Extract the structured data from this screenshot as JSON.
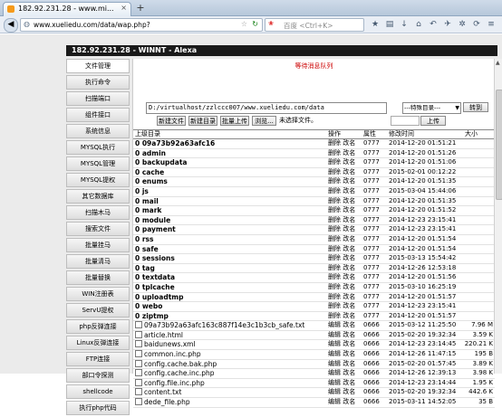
{
  "browser": {
    "tab_title": "182.92.231.28 - WINNT - Alexa",
    "tab_title_short": "182.92.231.28 - www.mi...",
    "tab_close": "×",
    "new_tab": "+",
    "url": "www.xueliedu.com/data/wap.php?",
    "search_placeholder": "百度 <Ctrl+K>"
  },
  "app": {
    "title": "182.92.231.28 - WINNT - Alexa",
    "status": "等待消息队列",
    "sidebar": [
      "文件管理",
      "执行命令",
      "扫描端口",
      "组件接口",
      "系统信息",
      "MYSQL执行",
      "MYSQL管理",
      "MYSQL提权",
      "其它数据库",
      "扫描木马",
      "搜索文件",
      "批量挂马",
      "批量清马",
      "批量替换",
      "WIN注册表",
      "ServU提权",
      "php反弹连接",
      "Linux反弹连接",
      "FTP连接",
      "部口令探测",
      "shellcode",
      "执行php代码"
    ],
    "path_value": "D:/virtualhost/zzlccc007/www.xueliedu.com/data",
    "special_dir": "---特殊目录---",
    "go_button": "转到",
    "buttons": [
      "新建文件",
      "新建目录",
      "批量上传",
      "浏览..."
    ],
    "no_file": "未选择文件。",
    "upload_button": "上传",
    "columns": [
      "上级目录",
      "操作",
      "属性",
      "修改时间",
      "大小"
    ],
    "dirs": [
      {
        "name": "0 09a73b92a63afc16",
        "ops": "删除 改名",
        "perm": "0777",
        "time": "2014-12-20 01:51:21"
      },
      {
        "name": "0 admin",
        "ops": "删除 改名",
        "perm": "0777",
        "time": "2014-12-20 01:51:26"
      },
      {
        "name": "0 backupdata",
        "ops": "删除 改名",
        "perm": "0777",
        "time": "2014-12-20 01:51:06"
      },
      {
        "name": "0 cache",
        "ops": "删除 改名",
        "perm": "0777",
        "time": "2015-02-01 00:12:22"
      },
      {
        "name": "0 enums",
        "ops": "删除 改名",
        "perm": "0777",
        "time": "2014-12-20 01:51:35"
      },
      {
        "name": "0 js",
        "ops": "删除 改名",
        "perm": "0777",
        "time": "2015-03-04 15:44:06"
      },
      {
        "name": "0 mail",
        "ops": "删除 改名",
        "perm": "0777",
        "time": "2014-12-20 01:51:35"
      },
      {
        "name": "0 mark",
        "ops": "删除 改名",
        "perm": "0777",
        "time": "2014-12-20 01:51:52"
      },
      {
        "name": "0 module",
        "ops": "删除 改名",
        "perm": "0777",
        "time": "2014-12-23 23:15:41"
      },
      {
        "name": "0 payment",
        "ops": "删除 改名",
        "perm": "0777",
        "time": "2014-12-23 23:15:41"
      },
      {
        "name": "0 rss",
        "ops": "删除 改名",
        "perm": "0777",
        "time": "2014-12-20 01:51:54"
      },
      {
        "name": "0 safe",
        "ops": "删除 改名",
        "perm": "0777",
        "time": "2014-12-20 01:51:54"
      },
      {
        "name": "0 sessions",
        "ops": "删除 改名",
        "perm": "0777",
        "time": "2015-03-13 15:54:42"
      },
      {
        "name": "0 tag",
        "ops": "删除 改名",
        "perm": "0777",
        "time": "2014-12-26 12:53:18"
      },
      {
        "name": "0 textdata",
        "ops": "删除 改名",
        "perm": "0777",
        "time": "2014-12-20 01:51:56"
      },
      {
        "name": "0 tplcache",
        "ops": "删除 改名",
        "perm": "0777",
        "time": "2015-03-10 16:25:19"
      },
      {
        "name": "0 uploadtmp",
        "ops": "删除 改名",
        "perm": "0777",
        "time": "2014-12-20 01:51:57"
      },
      {
        "name": "0 webo",
        "ops": "删除 改名",
        "perm": "0777",
        "time": "2014-12-23 23:15:41"
      },
      {
        "name": "0 ziptmp",
        "ops": "删除 改名",
        "perm": "0777",
        "time": "2014-12-20 01:51:57"
      }
    ],
    "files": [
      {
        "name": "09a73b92a63afc163c887f14e3c1b3cb_safe.txt",
        "ops": "编辑 改名",
        "perm": "0666",
        "time": "2015-03-12 11:25:50",
        "size": "7.96 M"
      },
      {
        "name": "article.html",
        "ops": "编辑 改名",
        "perm": "0666",
        "time": "2015-02-20 19:32:34",
        "size": "3.59 K"
      },
      {
        "name": "baidunews.xml",
        "ops": "编辑 改名",
        "perm": "0666",
        "time": "2014-12-23 23:14:45",
        "size": "220.21 K"
      },
      {
        "name": "common.inc.php",
        "ops": "编辑 改名",
        "perm": "0666",
        "time": "2014-12-26 11:47:15",
        "size": "195 B"
      },
      {
        "name": "config.cache.bak.php",
        "ops": "编辑 改名",
        "perm": "0666",
        "time": "2015-02-20 01:57:45",
        "size": "3.89 K"
      },
      {
        "name": "config.cache.inc.php",
        "ops": "编辑 改名",
        "perm": "0666",
        "time": "2014-12-26 12:39:13",
        "size": "3.98 K"
      },
      {
        "name": "config.file.inc.php",
        "ops": "编辑 改名",
        "perm": "0666",
        "time": "2014-12-23 23:14:44",
        "size": "1.95 K"
      },
      {
        "name": "content.txt",
        "ops": "编辑 改名",
        "perm": "0666",
        "time": "2015-02-20 19:32:34",
        "size": "442.6 K"
      },
      {
        "name": "dede_file.php",
        "ops": "编辑 改名",
        "perm": "0666",
        "time": "2015-03-11 14:52:05",
        "size": "35 B"
      }
    ]
  }
}
